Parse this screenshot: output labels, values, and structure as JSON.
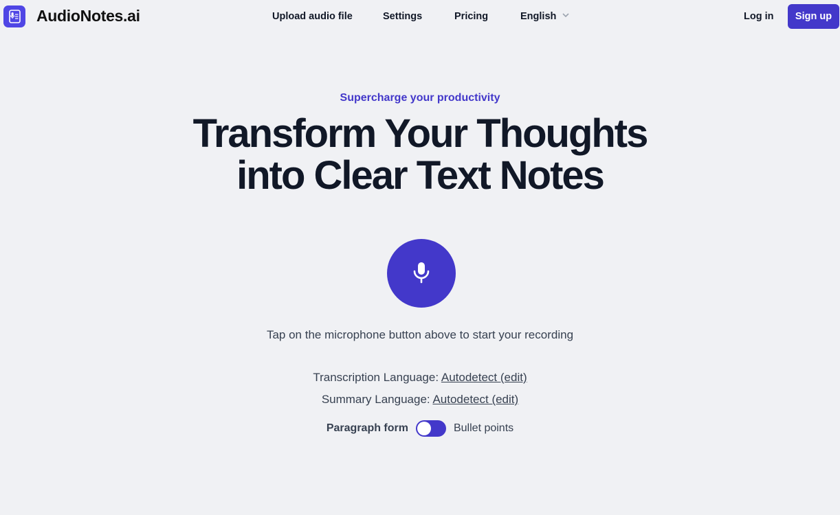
{
  "header": {
    "brand": "AudioNotes.ai",
    "nav": {
      "upload": "Upload audio file",
      "settings": "Settings",
      "pricing": "Pricing",
      "language": "English"
    },
    "login": "Log in",
    "signup": "Sign up"
  },
  "hero": {
    "eyebrow": "Supercharge your productivity",
    "title_line1": "Transform Your Thoughts",
    "title_line2": "into Clear Text Notes"
  },
  "recorder": {
    "hint": "Tap on the microphone button above to start your recording"
  },
  "languages": {
    "transcription_label": "Transcription Language:",
    "transcription_value": "Autodetect (edit)",
    "summary_label": "Summary Language:",
    "summary_value": "Autodetect (edit)"
  },
  "format_toggle": {
    "left_label": "Paragraph form",
    "right_label": "Bullet points"
  },
  "colors": {
    "accent": "#4338ca",
    "background": "#f0f1f4",
    "text": "#111827"
  },
  "icons": [
    "app-logo-icon",
    "chevron-down-icon",
    "microphone-icon"
  ]
}
